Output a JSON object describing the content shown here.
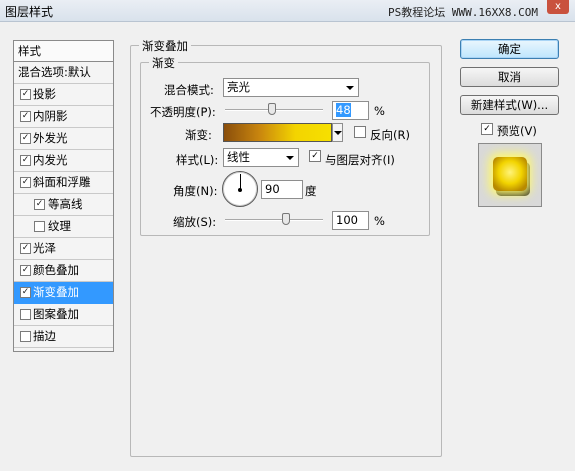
{
  "window": {
    "title": "图层样式",
    "watermark": "PS教程论坛 WWW.16XX8.COM",
    "close_glyph": "x"
  },
  "stylelist": {
    "header": "样式",
    "items": [
      {
        "label": "混合选项:默认",
        "checkbox": false,
        "checked": false,
        "selected": false
      },
      {
        "label": "投影",
        "checkbox": true,
        "checked": true,
        "selected": false
      },
      {
        "label": "内阴影",
        "checkbox": true,
        "checked": true,
        "selected": false
      },
      {
        "label": "外发光",
        "checkbox": true,
        "checked": true,
        "selected": false
      },
      {
        "label": "内发光",
        "checkbox": true,
        "checked": true,
        "selected": false
      },
      {
        "label": "斜面和浮雕",
        "checkbox": true,
        "checked": true,
        "selected": false
      },
      {
        "label": "等高线",
        "checkbox": true,
        "checked": true,
        "selected": false,
        "sub": true
      },
      {
        "label": "纹理",
        "checkbox": true,
        "checked": false,
        "selected": false,
        "sub": true
      },
      {
        "label": "光泽",
        "checkbox": true,
        "checked": true,
        "selected": false
      },
      {
        "label": "颜色叠加",
        "checkbox": true,
        "checked": true,
        "selected": false
      },
      {
        "label": "渐变叠加",
        "checkbox": true,
        "checked": true,
        "selected": true
      },
      {
        "label": "图案叠加",
        "checkbox": true,
        "checked": false,
        "selected": false
      },
      {
        "label": "描边",
        "checkbox": true,
        "checked": false,
        "selected": false
      }
    ]
  },
  "panel": {
    "outer_legend": "渐变叠加",
    "inner_legend": "渐变",
    "blend_mode_label": "混合模式:",
    "blend_mode_value": "亮光",
    "opacity_label": "不透明度(P):",
    "opacity_value": "48",
    "opacity_unit": "%",
    "opacity_level": 0.48,
    "gradient_label": "渐变:",
    "reverse_label": "反向(R)",
    "reverse_checked": false,
    "style_label": "样式(L):",
    "style_value": "线性",
    "align_label": "与图层对齐(I)",
    "align_checked": true,
    "angle_label": "角度(N):",
    "angle_value": "90",
    "angle_unit": "度",
    "scale_label": "缩放(S):",
    "scale_value": "100",
    "scale_unit": "%",
    "scale_level": 1.0,
    "gradient_colors": [
      "#8a4e0c",
      "#c9860e",
      "#f3d400",
      "#f6e000"
    ]
  },
  "buttons": {
    "ok": "确定",
    "cancel": "取消",
    "new_style": "新建样式(W)...",
    "preview_label": "预览(V)",
    "preview_checked": true
  },
  "check_glyph": "✓"
}
